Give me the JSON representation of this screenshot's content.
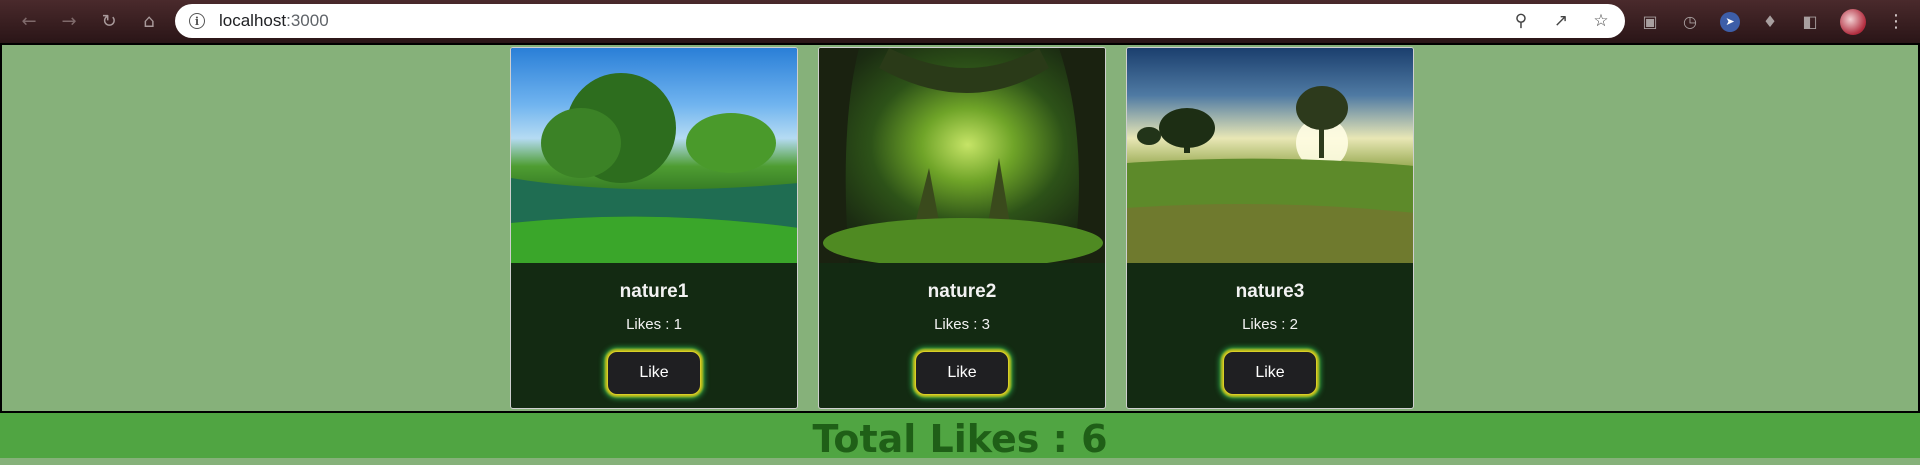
{
  "browser": {
    "url_host": "localhost",
    "url_port": ":3000",
    "icons": [
      "back-arrow-icon",
      "forward-arrow-icon",
      "reload-icon",
      "home-icon",
      "info-icon",
      "zoom-out-icon",
      "share-icon",
      "star-icon"
    ]
  },
  "cards": [
    {
      "title": "nature1",
      "likes_text": "Likes : 1",
      "likes": 1,
      "button_label": "Like"
    },
    {
      "title": "nature2",
      "likes_text": "Likes : 3",
      "likes": 3,
      "button_label": "Like"
    },
    {
      "title": "nature3",
      "likes_text": "Likes : 2",
      "likes": 2,
      "button_label": "Like"
    }
  ],
  "footer": {
    "total_text": "Total Likes : 6"
  },
  "colors": {
    "page_background": "#86b17a",
    "card_background": "#132a12",
    "footer_background": "#50a542",
    "footer_text": "#1f5f17",
    "button_background": "#1f1f22"
  }
}
